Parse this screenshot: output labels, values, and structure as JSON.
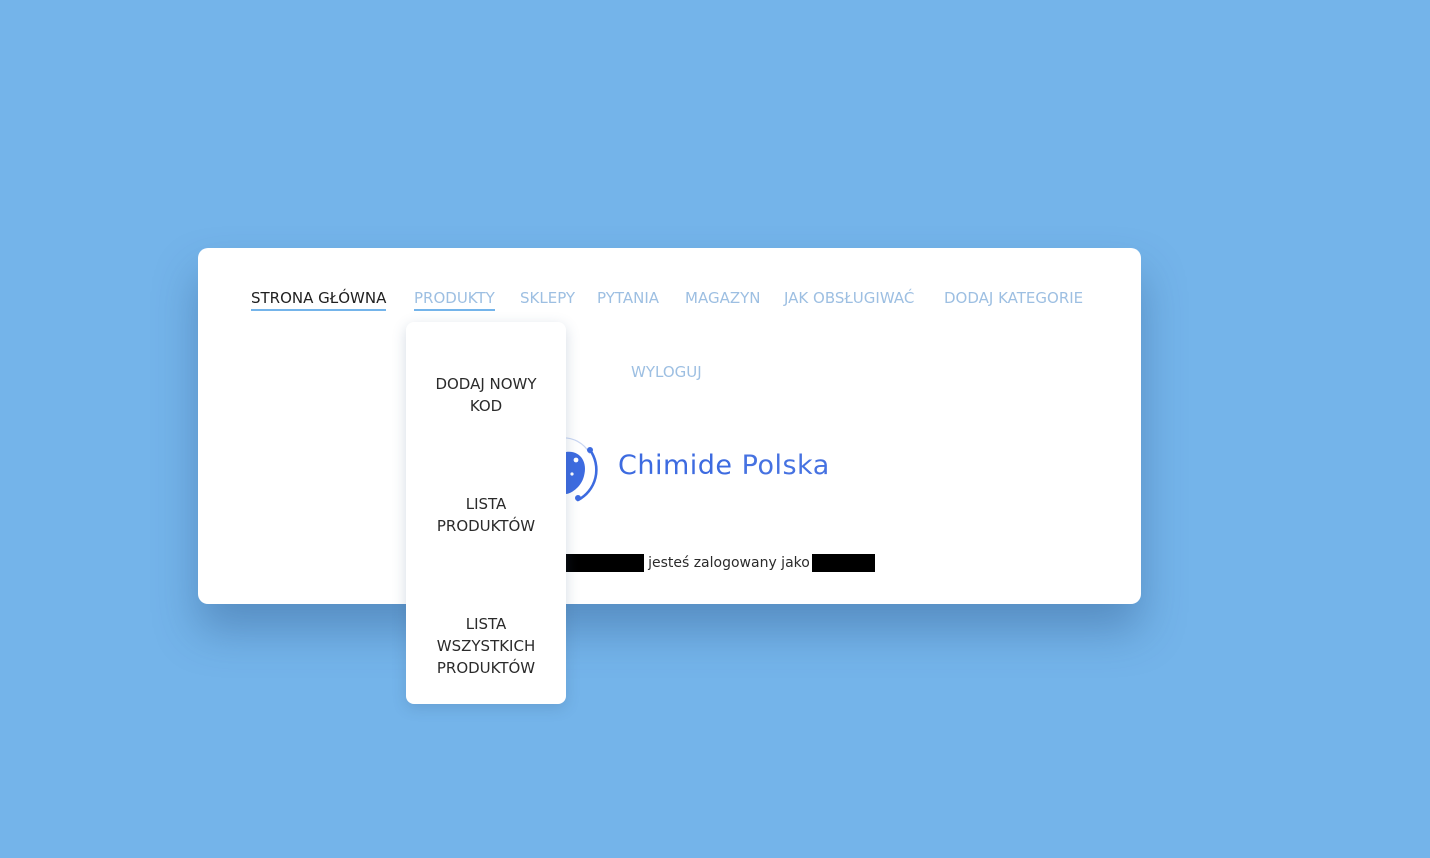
{
  "colors": {
    "background": "#74b4ea",
    "card": "#ffffff",
    "nav_link": "#9dbfe2",
    "nav_active": "#1f1f1f",
    "underline": "#74b4ea",
    "brand": "#3d6be0"
  },
  "nav": {
    "items": [
      {
        "label": "STRONA GŁÓWNA"
      },
      {
        "label": "PRODUKTY"
      },
      {
        "label": "SKLEPY"
      },
      {
        "label": "PYTANIA"
      },
      {
        "label": "MAGAZYN"
      },
      {
        "label": "JAK OBSŁUGIWAĆ"
      },
      {
        "label": "DODAJ KATEGORIE"
      },
      {
        "label": "WYLOGUJ"
      }
    ]
  },
  "dropdown": {
    "items": [
      {
        "label_line1": "DODAJ NOWY",
        "label_line2": "KOD"
      },
      {
        "label_line1": "LISTA",
        "label_line2": "PRODUKTÓW"
      },
      {
        "label_line1": "LISTA",
        "label_line2": "WSZYSTKICH",
        "label_line3": "PRODUKTÓW"
      }
    ]
  },
  "brand": {
    "logo_icon": "flask-atom-logo-icon",
    "name_part1": "Chimide",
    "name_part2": "Polska"
  },
  "login": {
    "dash": "-",
    "text": "jesteś zalogowany jako"
  }
}
